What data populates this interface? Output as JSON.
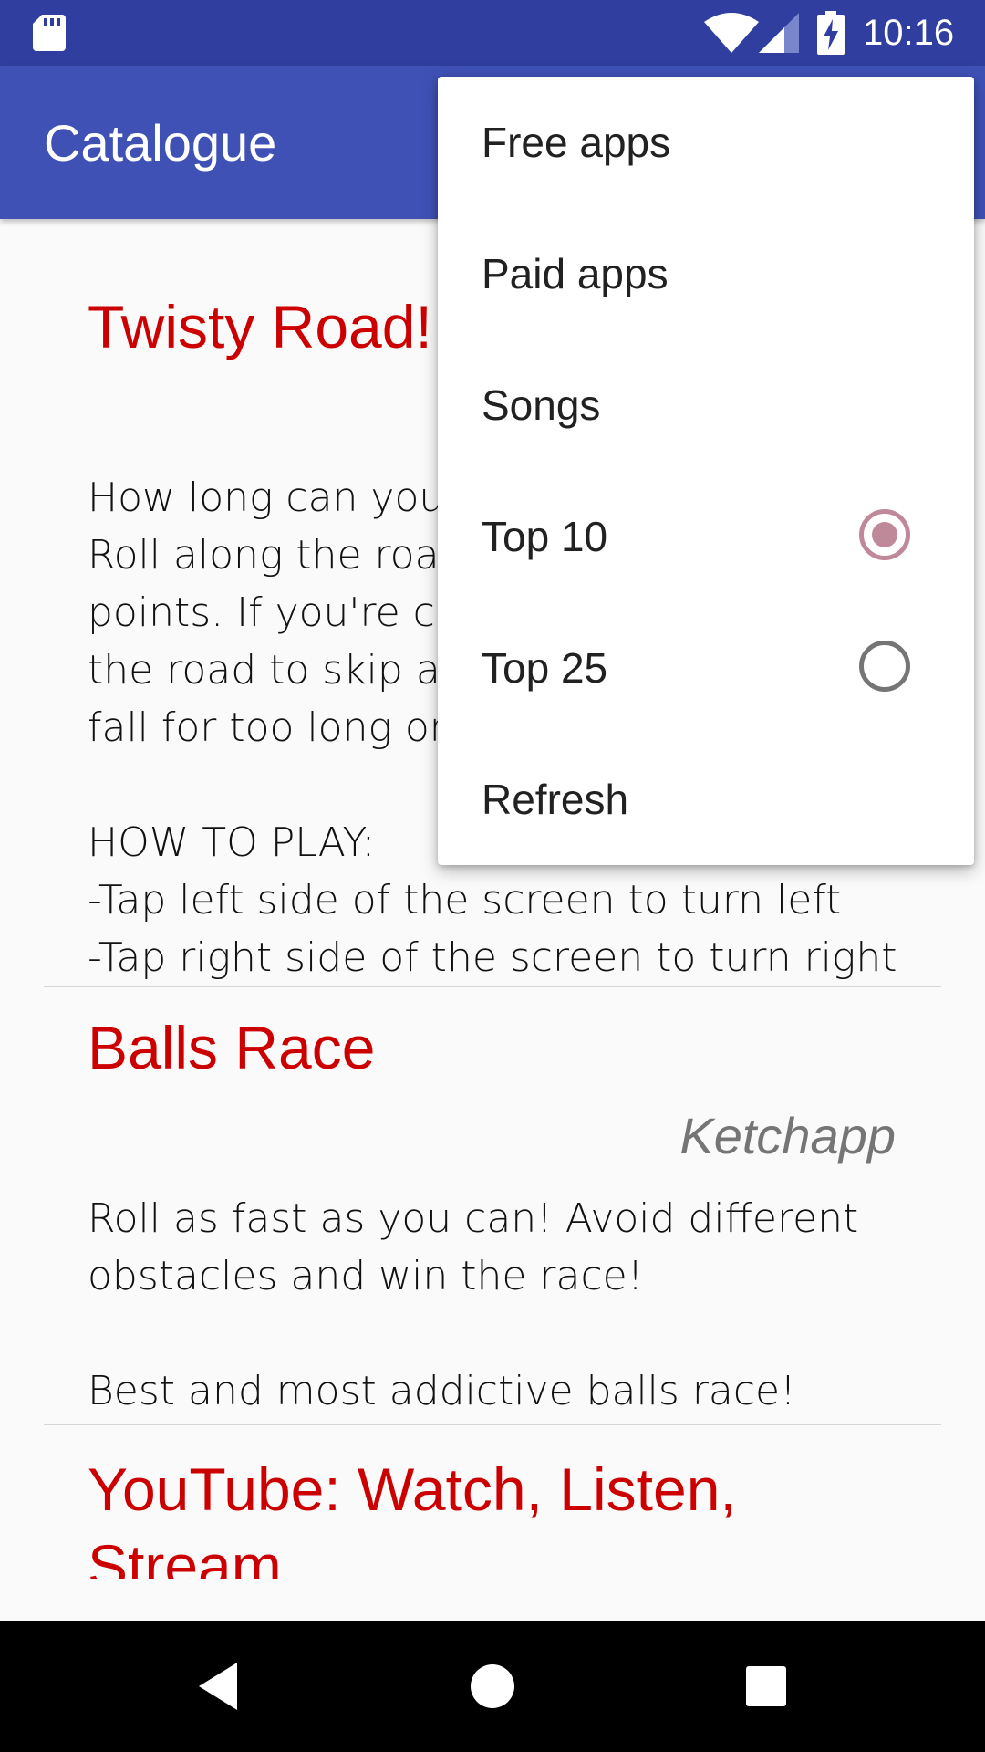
{
  "status_bar": {
    "time": "10:16",
    "icons": [
      "sd-card-icon",
      "wifi-icon",
      "cell-signal-icon",
      "battery-charging-icon"
    ],
    "background": "#303f9f"
  },
  "app_bar": {
    "title": "Catalogue",
    "background": "#3f51b5"
  },
  "entries": [
    {
      "title": "Twisty Road!",
      "description": "How long can you st\nRoll along the road c\npoints. If you're cour\nthe road to skip ahe\nfall for too long or g\n\nHOW TO PLAY:\n-Tap left side of the screen to turn left\n-Tap right side of the screen to turn right"
    },
    {
      "title": "Balls Race",
      "developer": "Ketchapp",
      "description": "Roll as fast as you can! Avoid different\nobstacles and win the race!\n\nBest and most addictive balls race!"
    },
    {
      "title": "YouTube: Watch, Listen,\nStream"
    }
  ],
  "title_color": "#cc0000",
  "menu": {
    "items": [
      {
        "label": "Free apps"
      },
      {
        "label": "Paid apps"
      },
      {
        "label": "Songs"
      },
      {
        "label": "Top 10",
        "radio": true,
        "checked": true
      },
      {
        "label": "Top 25",
        "radio": true,
        "checked": false
      },
      {
        "label": "Refresh"
      }
    ],
    "accent": "#c0899a"
  },
  "nav_bar": {
    "buttons": [
      "back-icon",
      "home-icon",
      "recents-icon"
    ]
  }
}
